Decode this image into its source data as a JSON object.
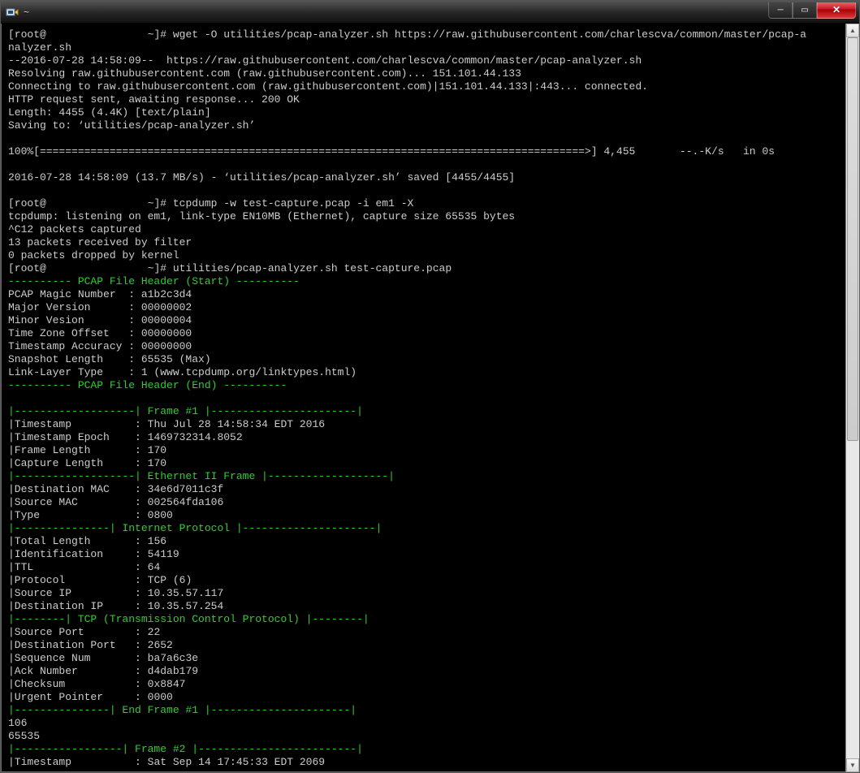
{
  "window": {
    "title": "~"
  },
  "prompt": {
    "user": "[root@",
    "host_gap": "                ",
    "end": "~]#"
  },
  "cmd": {
    "wget": "wget -O utilities/pcap-analyzer.sh https://raw.githubusercontent.com/charlescva/common/master/pcap-a",
    "wget2": "nalyzer.sh",
    "tcpdump": "tcpdump -w test-capture.pcap -i em1 -X",
    "analyze": "utilities/pcap-analyzer.sh test-capture.pcap"
  },
  "wget_out": {
    "l1": "--2016-07-28 14:58:09--  https://raw.githubusercontent.com/charlescva/common/master/pcap-analyzer.sh",
    "l2": "Resolving raw.githubusercontent.com (raw.githubusercontent.com)... 151.101.44.133",
    "l3": "Connecting to raw.githubusercontent.com (raw.githubusercontent.com)|151.101.44.133|:443... connected.",
    "l4": "HTTP request sent, awaiting response... 200 OK",
    "l5": "Length: 4455 (4.4K) [text/plain]",
    "l6": "Saving to: ‘utilities/pcap-analyzer.sh’",
    "prog": "100%[======================================================================================>] 4,455       --.-K/s   in 0s",
    "done": "2016-07-28 14:58:09 (13.7 MB/s) - ‘utilities/pcap-analyzer.sh’ saved [4455/4455]"
  },
  "tcpdump_out": {
    "l1": "tcpdump: listening on em1, link-type EN10MB (Ethernet), capture size 65535 bytes",
    "l2": "^C12 packets captured",
    "l3": "13 packets received by filter",
    "l4": "0 packets dropped by kernel"
  },
  "pcap": {
    "hdr_start": "---------- PCAP File Header (Start) ----------",
    "hdr_end": "---------- PCAP File Header (End) ----------",
    "fields": [
      {
        "k": "PCAP Magic Number  : ",
        "v": "a1b2c3d4"
      },
      {
        "k": "Major Version      : ",
        "v": "00000002"
      },
      {
        "k": "Minor Vesion       : ",
        "v": "00000004"
      },
      {
        "k": "Time Zone Offset   : ",
        "v": "00000000"
      },
      {
        "k": "Timestamp Accuracy : ",
        "v": "00000000"
      },
      {
        "k": "Snapshot Length    : ",
        "v": "65535 (Max)"
      },
      {
        "k": "Link-Layer Type    : ",
        "v": "1 (www.tcpdump.org/linktypes.html)"
      }
    ]
  },
  "frame1": {
    "h_frame": "|-------------------| Frame #1 |-----------------------|",
    "h_eth": "|-------------------| Ethernet II Frame |-------------------|",
    "h_ip": "|---------------| Internet Protocol |---------------------|",
    "h_tcp": "|--------| TCP (Transmission Control Protocol) |--------|",
    "h_end": "|---------------| End Frame #1 |----------------------|",
    "rows": [
      {
        "k": "|Timestamp          : ",
        "v": "Thu Jul 28 14:58:34 EDT 2016"
      },
      {
        "k": "|Timestamp Epoch    : ",
        "v": "1469732314.8052"
      },
      {
        "k": "|Frame Length       : ",
        "v": "170"
      },
      {
        "k": "|Capture Length     : ",
        "v": "170"
      }
    ],
    "eth": [
      {
        "k": "|Destination MAC    : ",
        "v": "34e6d7011c3f"
      },
      {
        "k": "|Source MAC         : ",
        "v": "002564fda106"
      },
      {
        "k": "|Type               : ",
        "v": "0800"
      }
    ],
    "ip": [
      {
        "k": "|Total Length       : ",
        "v": "156"
      },
      {
        "k": "|Identification     : ",
        "v": "54119"
      },
      {
        "k": "|TTL                : ",
        "v": "64"
      },
      {
        "k": "|Protocol           : ",
        "v": "TCP (6)"
      },
      {
        "k": "|Source IP          : ",
        "v": "10.35.57.117"
      },
      {
        "k": "|Destination IP     : ",
        "v": "10.35.57.254"
      }
    ],
    "tcp": [
      {
        "k": "|Source Port        : ",
        "v": "22"
      },
      {
        "k": "|Destination Port   : ",
        "v": "2652"
      },
      {
        "k": "|Sequence Num       : ",
        "v": "ba7a6c3e"
      },
      {
        "k": "|Ack Number         : ",
        "v": "d4dab179"
      },
      {
        "k": "|Checksum           : ",
        "v": "0x8847"
      },
      {
        "k": "|Urgent Pointer     : ",
        "v": "0000"
      }
    ]
  },
  "tail": {
    "n1": "106",
    "n2": "65535"
  },
  "frame2": {
    "h_frame": "|-----------------| Frame #2 |-------------------------|",
    "row1": {
      "k": "|Timestamp          : ",
      "v": "Sat Sep 14 17:45:33 EDT 2069"
    }
  },
  "scrollbar": {
    "thumb_top_pct": 0,
    "thumb_height_pct": 56
  }
}
